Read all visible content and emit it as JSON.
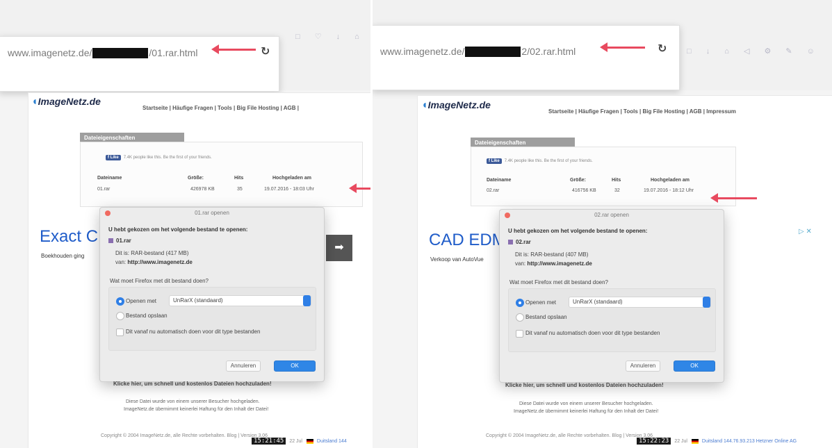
{
  "left": {
    "url_prefix": "www.imagenetz.de/",
    "url_suffix": "/01.rar.html",
    "toolbar_icons": "□ ♡ ↓ ⌂ ◁ ☺",
    "reload_icon": "reload-icon",
    "logo": "ImageNetz.de",
    "nav": "Startseite | Häufige Fragen | Tools | Big File Hosting | AGB |",
    "props_header": "Dateieigenschaften",
    "fb_like": "Like",
    "fb_text": "7.4K people like this. Be the first of your friends.",
    "table": {
      "headers": [
        "Dateiname",
        "Größe:",
        "Hits",
        "Hochgeladen am"
      ],
      "row": [
        "01.rar",
        "426978 KB",
        "35",
        "19.07.2016 - 18:03 Uhr"
      ]
    },
    "ad_title": "Exact C",
    "ad_sub": "Boekhouden ging",
    "dialog": {
      "title": "01.rar openen",
      "question": "U hebt gekozen om het volgende bestand te openen:",
      "filename": "01.rar",
      "type_label": "Dit is:",
      "type_value": "RAR-bestand (417 MB)",
      "from_label": "van:",
      "from_value": "http://www.imagenetz.de",
      "ask": "Wat moet Firefox met dit bestand doen?",
      "open_with_label": "Openen met",
      "open_with_value": "UnRarX (standaard)",
      "save_label": "Bestand opslaan",
      "auto_label": "Dit vanaf nu automatisch doen voor dit type bestanden",
      "cancel": "Annuleren",
      "ok": "OK"
    },
    "footer_bold": "Klicke hier, um schnell und kostenlos Dateien hochzuladen!",
    "footer_line1": "Diese Datei wurde von einem unserer Besucher hochgeladen.",
    "footer_line2": "ImageNetz.de übernimmt keinerlei Haftung für den Inhalt der Datei!",
    "copyright": "Copyright © 2004 ImageNetz.de, alle Rechte vorbehalten. Blog | Version 3.06",
    "clock": "15:21:45",
    "status_date": "22 Jul",
    "status_link": "Duitsland 144"
  },
  "right": {
    "url_prefix": "www.imagenetz.de/",
    "url_suffix": "2/02.rar.html",
    "toolbar_icons": "□ ↓ ⌂ ◁ ⚙ ✎ ☺",
    "reload_icon": "reload-icon",
    "logo": "ImageNetz.de",
    "nav": "Startseite | Häufige Fragen | Tools | Big File Hosting | AGB | Impressum",
    "props_header": "Dateieigenschaften",
    "fb_like": "Like",
    "fb_text": "7.4K people like this. Be the first of your friends.",
    "table": {
      "headers": [
        "Dateiname",
        "Größe:",
        "Hits",
        "Hochgeladen am"
      ],
      "row": [
        "02.rar",
        "416756 KB",
        "32",
        "19.07.2016 - 18:12 Uhr"
      ]
    },
    "ad_title": "CAD EDM",
    "ad_sub": "Verkoop van AutoVue",
    "ad_close": "▷ ✕",
    "dialog": {
      "title": "02.rar openen",
      "question": "U hebt gekozen om het volgende bestand te openen:",
      "filename": "02.rar",
      "type_label": "Dit is:",
      "type_value": "RAR-bestand (407 MB)",
      "from_label": "van:",
      "from_value": "http://www.imagenetz.de",
      "ask": "Wat moet Firefox met dit bestand doen?",
      "open_with_label": "Openen met",
      "open_with_value": "UnRarX (standaard)",
      "save_label": "Bestand opslaan",
      "auto_label": "Dit vanaf nu automatisch doen voor dit type bestanden",
      "cancel": "Annuleren",
      "ok": "OK"
    },
    "footer_bold": "Klicke hier, um schnell und kostenlos Dateien hochzuladen!",
    "footer_line1": "Diese Datei wurde von einem unserer Besucher hochgeladen.",
    "footer_line2": "ImageNetz.de übernimmt keinerlei Haftung für den Inhalt der Datei!",
    "copyright": "Copyright © 2004 ImageNetz.de, alle Rechte vorbehalten. Blog | Version 3.06",
    "clock": "15:22:23",
    "status_date": "22 Jul",
    "status_link": "Duitsland 144.76.93.213 Hetzner Online AG"
  },
  "colors": {
    "annotation_arrow": "#e84a5f",
    "ad_title": "#1f5cc9",
    "ok_button": "#2f86e6",
    "props_header": "#9e9e9e"
  }
}
